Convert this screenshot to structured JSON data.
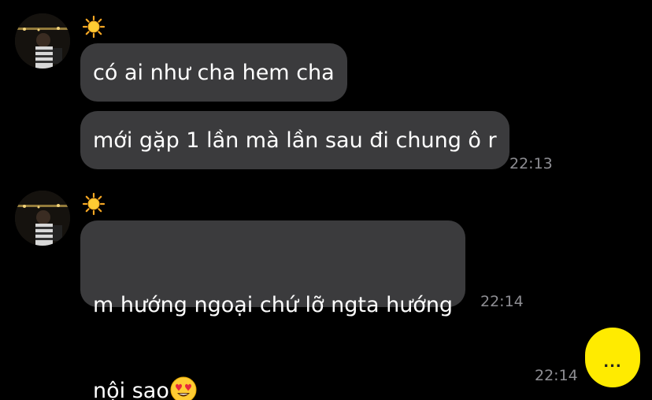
{
  "messages": {
    "group1": {
      "sender_icon": "sun-icon",
      "bubble1": "có ai như cha hem cha",
      "bubble2": "mới gặp 1 lần mà lần sau đi chung ô r",
      "time": "22:13"
    },
    "group2": {
      "sender_icon": "sun-icon",
      "bubble_line1": "m hướng ngoại chứ lỡ ngta hướng",
      "bubble_line2": "nội sao",
      "bubble_emoji": "heart-eyes-emoji-icon",
      "time": "22:14"
    },
    "outgoing": {
      "typing_indicator": "...",
      "time": "22:14"
    }
  },
  "colors": {
    "background": "#000000",
    "bubble_incoming": "#3b3b3d",
    "bubble_outgoing": "#ffeb00",
    "timestamp": "#8e8e93",
    "text": "#ffffff"
  }
}
